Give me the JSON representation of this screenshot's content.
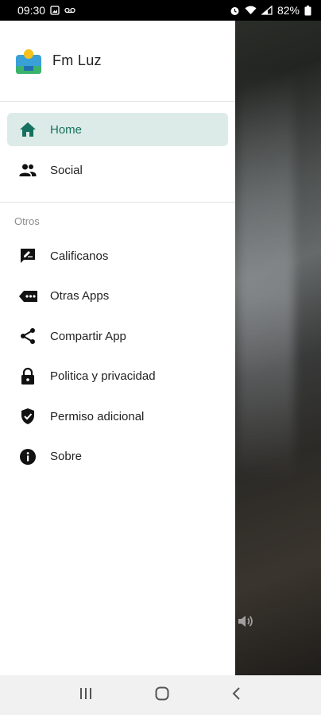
{
  "status_bar": {
    "time": "09:30",
    "battery": "82%"
  },
  "drawer": {
    "app_name": "Fm Luz",
    "primary_items": [
      {
        "label": "Home",
        "icon": "home-icon",
        "active": true
      },
      {
        "label": "Social",
        "icon": "people-icon",
        "active": false
      }
    ],
    "section_label": "Otros",
    "secondary_items": [
      {
        "label": "Calificanos",
        "icon": "rate-review-icon"
      },
      {
        "label": "Otras Apps",
        "icon": "more-apps-icon"
      },
      {
        "label": "Compartir App",
        "icon": "share-icon"
      },
      {
        "label": "Politica y privacidad",
        "icon": "lock-icon"
      },
      {
        "label": "Permiso adicional",
        "icon": "shield-check-icon"
      },
      {
        "label": "Sobre",
        "icon": "info-icon"
      }
    ]
  },
  "colors": {
    "accent": "#16705f",
    "active_bg": "#dcebe7"
  }
}
